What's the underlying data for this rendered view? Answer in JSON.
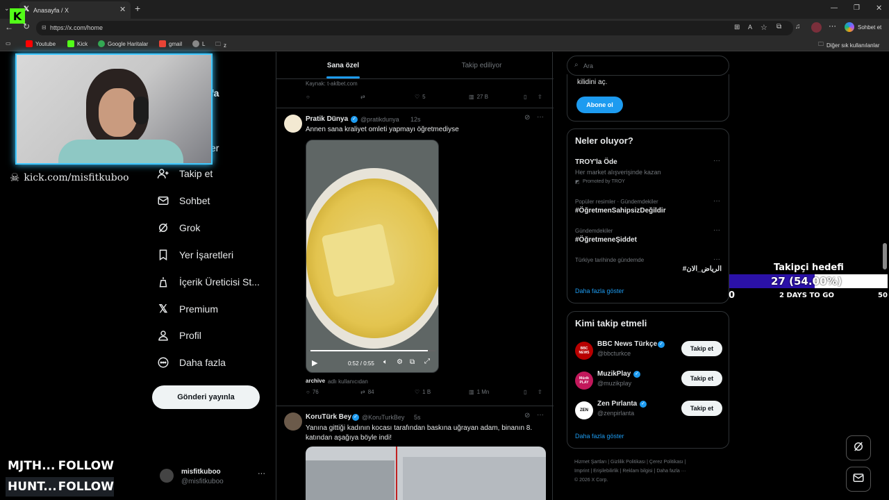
{
  "browser": {
    "tab_title": "Anasayfa / X",
    "url": "https://x.com/home",
    "copilot_label": "Sohbet et",
    "bookmarks": [
      "Youtube",
      "Kick",
      "Google Haritalar",
      "gmail",
      "L",
      "z"
    ],
    "other_bookmarks": "Diğer sık kullanılanlar"
  },
  "stream_overlay": {
    "kick_url": "kick.com/misfitkuboo",
    "events": [
      {
        "name": "MJTH...",
        "action": "FOLLOW"
      },
      {
        "name": "HUNT...",
        "action": "FOLLOW"
      }
    ],
    "goal": {
      "title": "Takipçi hedefi",
      "current_text": "27 (54.00%)",
      "progress": 0.54,
      "min": "0",
      "max": "50",
      "remaining": "2 DAYS TO GO"
    }
  },
  "sidebar": {
    "partial_items": [
      "fa",
      "er"
    ],
    "items": [
      {
        "label": "Takip et",
        "icon": "add-person-icon"
      },
      {
        "label": "Sohbet",
        "icon": "mail-icon"
      },
      {
        "label": "Grok",
        "icon": "grok-icon"
      },
      {
        "label": "Yer İşaretleri",
        "icon": "bookmark-icon"
      },
      {
        "label": "İçerik Üreticisi St...",
        "icon": "creator-icon"
      },
      {
        "label": "Premium",
        "icon": "x-logo-icon"
      },
      {
        "label": "Profil",
        "icon": "profile-icon"
      },
      {
        "label": "Daha fazla",
        "icon": "more-circle-icon"
      }
    ],
    "post_button": "Gönderi yayınla",
    "account": {
      "name": "misfitkuboo",
      "handle": "@misfitkuboo"
    }
  },
  "feed": {
    "tabs": [
      "Sana özel",
      "Takip ediliyor"
    ],
    "prev_post": {
      "source": "Kaynak: t-aklbet.com",
      "likes": "5",
      "views": "27 B"
    },
    "post1": {
      "name": "Pratik Dünya",
      "handle": "@pratikdunya",
      "time": "12s",
      "text": "Annen sana kraliyet omleti yapmayı öğretmediyse",
      "video_time": "0:52 / 0:55",
      "credit_user": "archive",
      "credit_suffix": "adlı kullanıcıdan",
      "replies": "76",
      "reposts": "84",
      "likes": "1 B",
      "views": "1 Mn"
    },
    "post2": {
      "name": "KoruTürk Bey",
      "handle": "@KoruTurkBey",
      "time": "5s",
      "text": "Yanına gittiği kadının kocası tarafından baskına uğrayan adam, binanın 8. katından aşağıya böyle indi!"
    }
  },
  "right": {
    "search_placeholder": "Ara",
    "premium_card": {
      "text": "kilidini aç.",
      "button": "Abone ol"
    },
    "trends": {
      "title": "Neler oluyor?",
      "items": [
        {
          "category": "",
          "name": "TROY'la Öde",
          "sub": "Her market alışverişinde kazan",
          "promo": "Promoted by TROY"
        },
        {
          "category": "Popüler resimler · Gündemdekiler",
          "name": "#ÖğretmenSahipsizDeğildir"
        },
        {
          "category": "Gündemdekiler",
          "name": "#ÖğretmeneŞiddet"
        },
        {
          "category": "Türkiye tarihinde gündemde",
          "name": "#الرياض_الان"
        }
      ],
      "more": "Daha fazla göster"
    },
    "who_to_follow": {
      "title": "Kimi takip etmeli",
      "accounts": [
        {
          "name": "BBC News Türkçe",
          "handle": "@bbcturkce",
          "avatar": "BBC NEWS"
        },
        {
          "name": "MuzikPlay",
          "handle": "@muzikplay",
          "avatar": "Müzik PLAY"
        },
        {
          "name": "Zen Pırlanta",
          "handle": "@zenpirlanta",
          "avatar": "ZEN"
        }
      ],
      "follow_label": "Takip et",
      "more": "Daha fazla göster"
    },
    "footer": {
      "links": [
        "Hizmet Şartları",
        "Gizlilik Politikası",
        "Çerez Politikası",
        "Imprint",
        "Erişilebilirlik",
        "Reklam bilgisi",
        "Daha fazla ···"
      ],
      "copyright": "© 2026 X Corp."
    }
  }
}
